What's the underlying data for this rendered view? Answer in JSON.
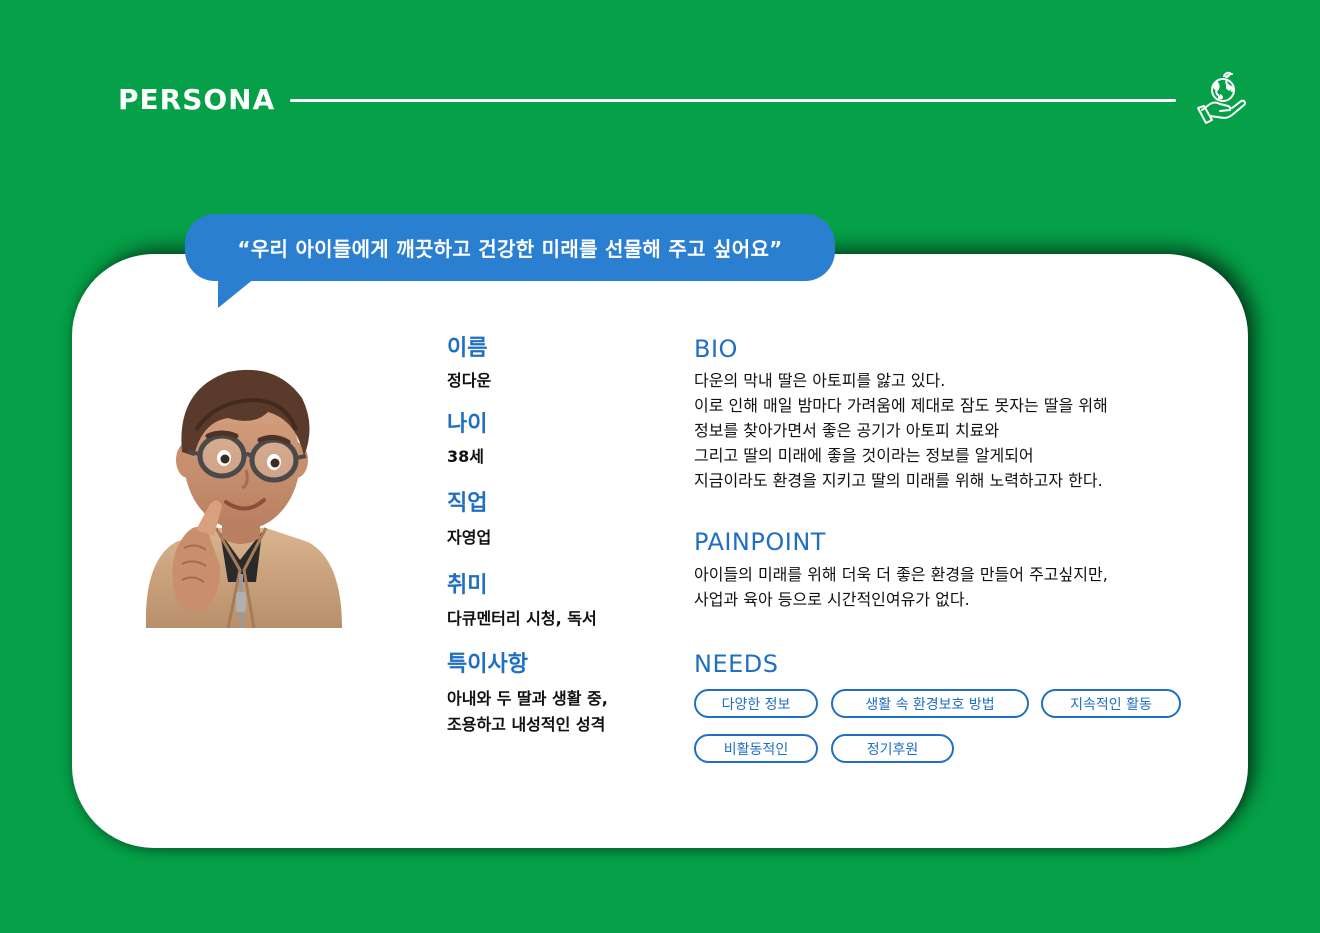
{
  "header": {
    "title": "PERSONA",
    "icon": "globe-in-hand-icon"
  },
  "quote": "“우리 아이들에게 깨끗하고 건강한 미래를 선물해 주고 싶어요”",
  "profile": {
    "avatar": "memoji-avatar",
    "name_label": "이름",
    "name": "정다운",
    "age_label": "나이",
    "age": "38세",
    "job_label": "직업",
    "job": "자영업",
    "hobby_label": "취미",
    "hobby": "다큐멘터리 시청, 독서",
    "notes_label": "특이사항",
    "notes": [
      "아내와 두 딸과 생활 중,",
      "조용하고 내성적인 성격"
    ]
  },
  "bio": {
    "title": "BIO",
    "lines": [
      "다운의 막내 딸은 아토피를 앓고 있다.",
      "이로 인해 매일 밤마다 가려움에 제대로 잠도 못자는 딸을 위해",
      "정보를 찾아가면서 좋은 공기가 아토피 치료와",
      "그리고 딸의 미래에 좋을 것이라는 정보를 알게되어",
      "지금이라도 환경을 지키고 딸의 미래를 위해 노력하고자 한다."
    ]
  },
  "painpoint": {
    "title": "PAINPOINT",
    "lines": [
      "아이들의 미래를 위해 더욱 더 좋은 환경을 만들어 주고싶지만,",
      "사업과 육아 등으로 시간적인여유가 없다."
    ]
  },
  "needs": {
    "title": "NEEDS",
    "chips": [
      "다양한 정보",
      "생활 속 환경보호 방법",
      "지속적인 활동",
      "비활동적인",
      "정기후원"
    ]
  },
  "colors": {
    "background": "#05a047",
    "accent": "#1f6fc3",
    "bubble": "#2b7fd1",
    "text": "#111111"
  }
}
